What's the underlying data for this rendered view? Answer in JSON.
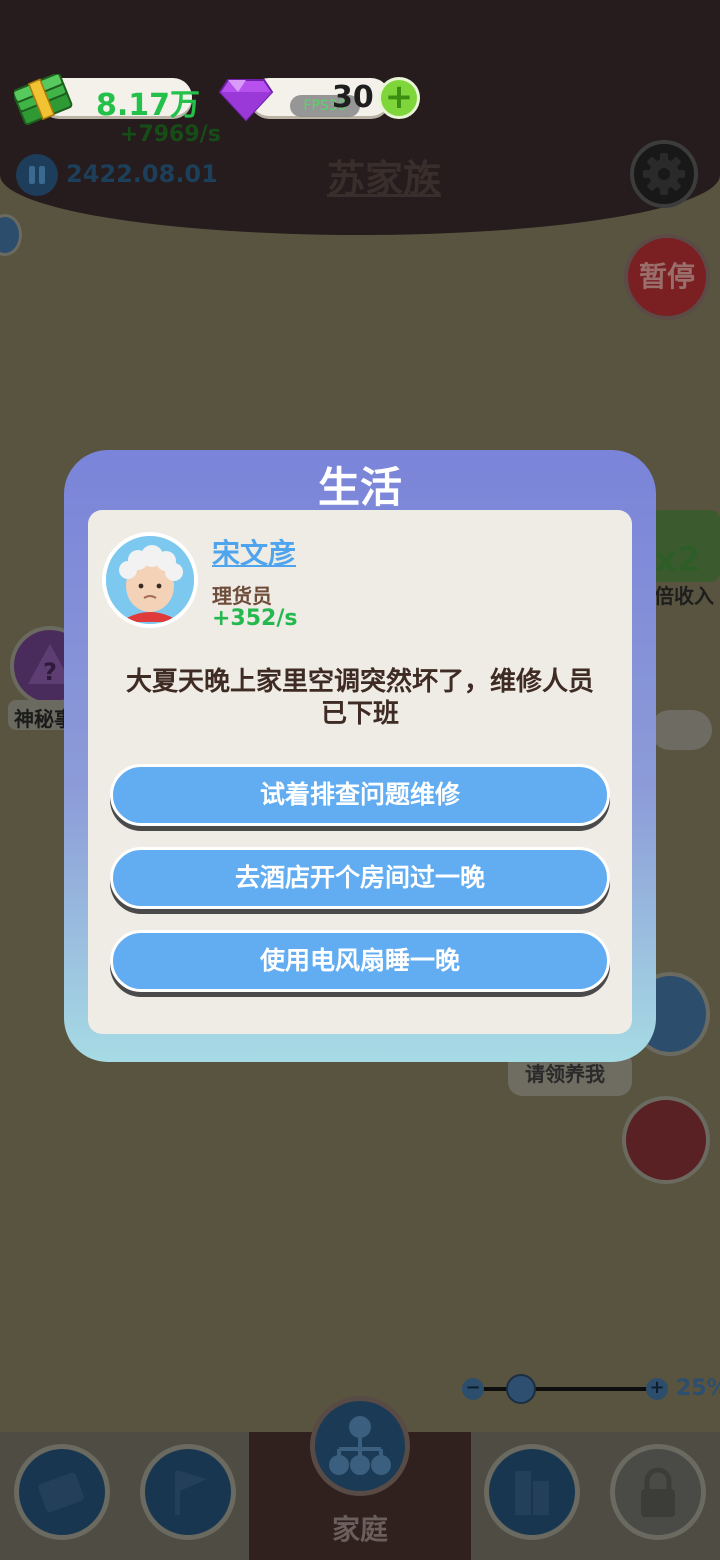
{
  "header": {
    "money": "8.17万",
    "gems": "30",
    "fps": "FPS30",
    "income_rate": "+7969/s",
    "date": "2422.08.01",
    "family_name": "苏家族"
  },
  "side": {
    "pause_label": "暂停",
    "mystery_label": "神秘事",
    "double_label": "x2",
    "double_income_label": "倍收入",
    "adopt_label": "请领养我"
  },
  "zoom": {
    "percent": "25%"
  },
  "dialog": {
    "title": "生活",
    "character": {
      "name": "宋文彦",
      "job": "理货员",
      "income": "+352/s"
    },
    "event_text": "大夏天晚上家里空调突然坏了，维修人员已下班",
    "choices": [
      "试着排查问题维修",
      "去酒店开个房间过一晚",
      "使用电风扇睡一晚"
    ]
  },
  "bottom_nav": {
    "active_label": "家庭"
  },
  "colors": {
    "dialog_top": "#7a84d9",
    "dialog_bottom": "#a6dbe4",
    "choice_button": "#62adf1",
    "money_text": "#23c14a"
  }
}
